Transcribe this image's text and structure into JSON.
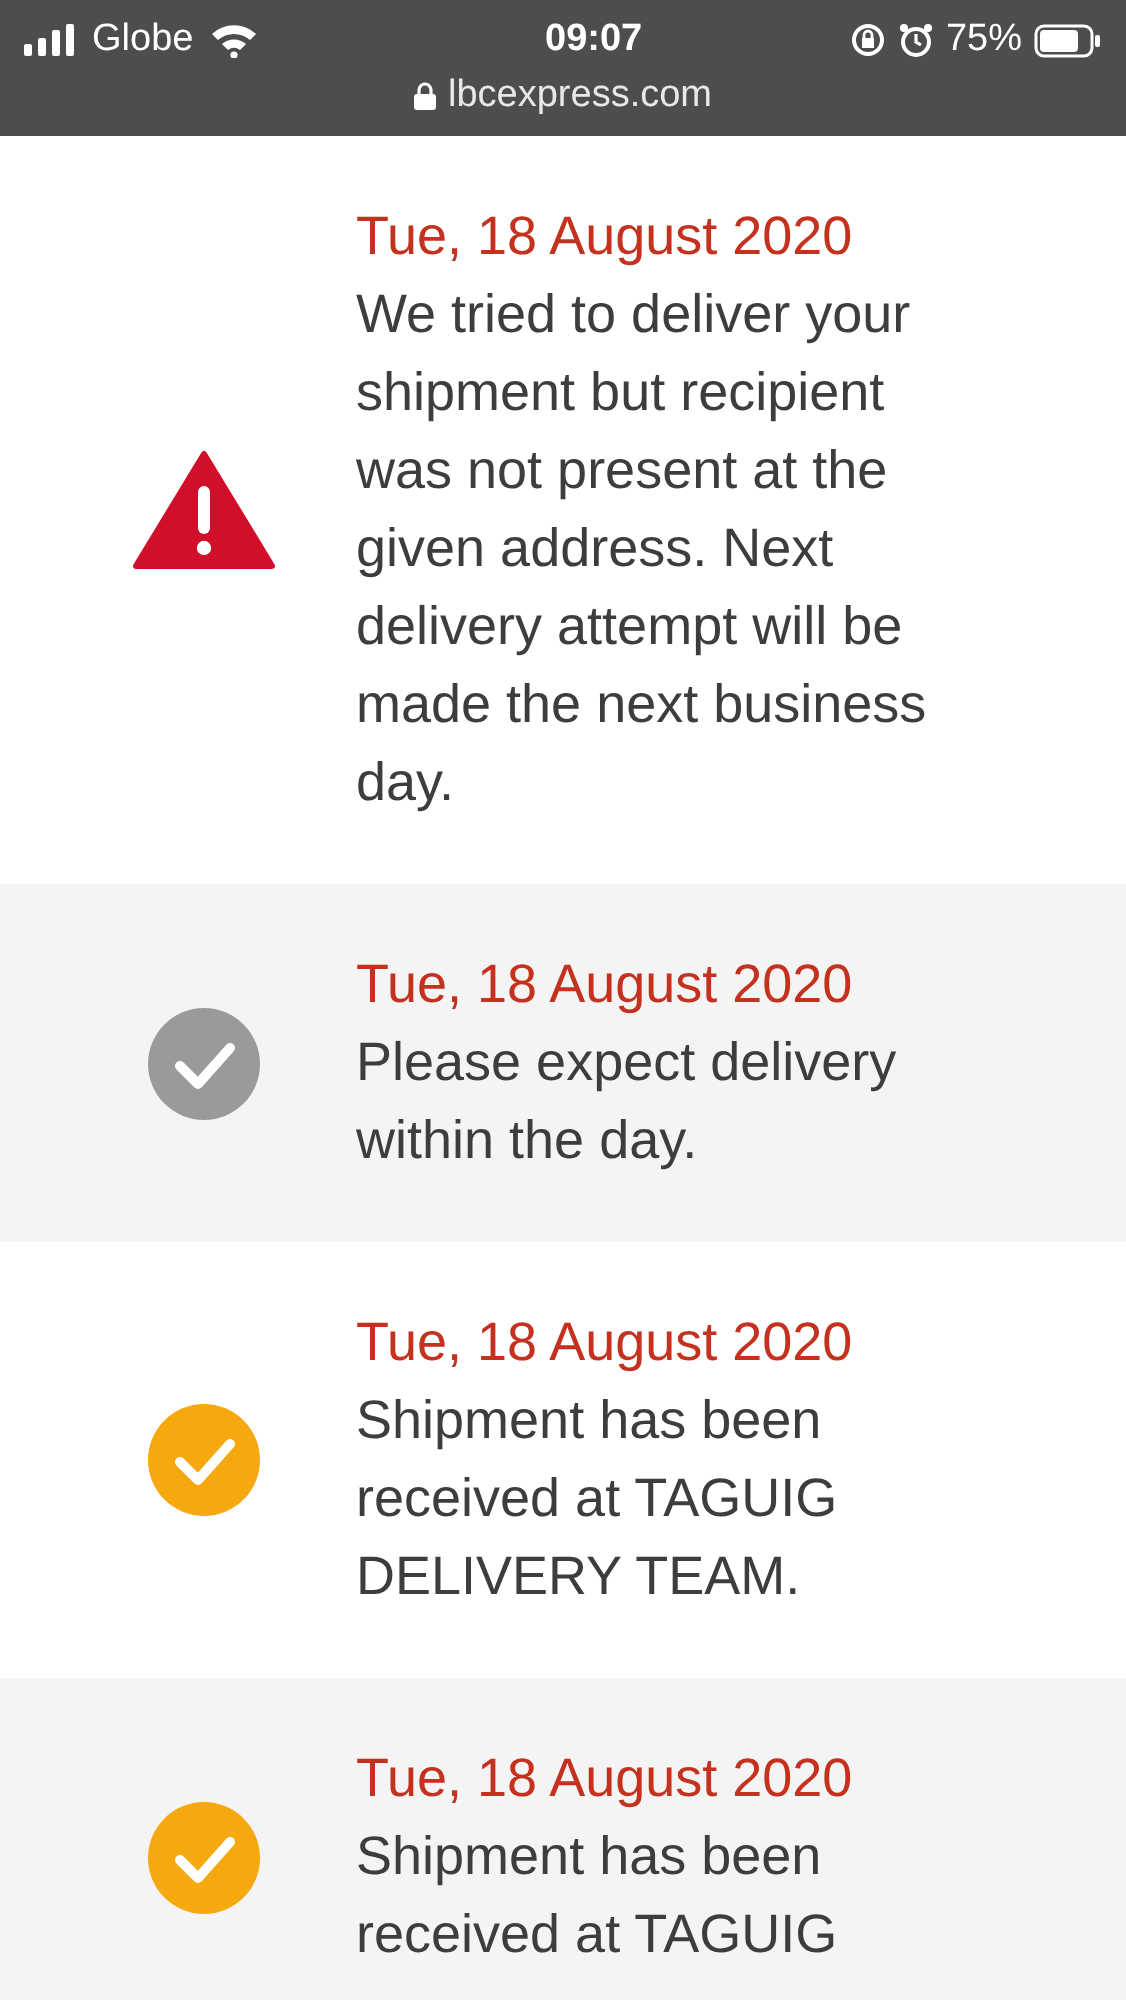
{
  "status_bar": {
    "carrier": "Globe",
    "time": "09:07",
    "battery": "75%"
  },
  "address_bar": {
    "url": "lbcexpress.com"
  },
  "events": [
    {
      "kind": "failed",
      "date": "Tue, 18 August 2020",
      "message": "We tried to deliver your shipment but recipient was not present at the given address. Next delivery attempt will be made the next business day."
    },
    {
      "kind": "pending",
      "date": "Tue, 18 August 2020",
      "message": "Please expect delivery within the day."
    },
    {
      "kind": "done",
      "date": "Tue, 18 August 2020",
      "message": "Shipment has been received at TAGUIG DELIVERY TEAM."
    },
    {
      "kind": "done",
      "date": "Tue, 18 August 2020",
      "message": "Shipment has been received at TAGUIG"
    }
  ]
}
